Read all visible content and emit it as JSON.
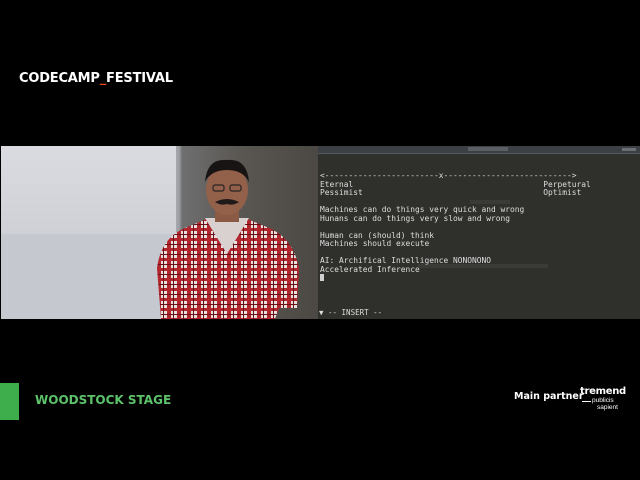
{
  "header": {
    "brand_main": "CODECAMP",
    "brand_accent": "_",
    "brand_tail": "FESTIVAL"
  },
  "colors": {
    "brand_accent": "#e84b1a",
    "stage_green": "#3dae4b",
    "terminal_bg": "#2f302c"
  },
  "terminal": {
    "lines": [
      "<------------------------x--------------------------->",
      "Eternal                                        Perpetural",
      "Pessimist                                      Optimist",
      "",
      "Machines can do things very quick and wrong",
      "Hunans can do things very slow and wrong",
      "",
      "Human can (should) think",
      "Machines should execute",
      "",
      "AI: Archifical Intelligence NONONONO",
      "Accelerated Inference"
    ],
    "mode": "-- INSERT --"
  },
  "footer": {
    "stage_name": "WOODSTOCK STAGE",
    "partner_label": "Main partner",
    "partner_logo_top": "tremend",
    "partner_logo_mid": "publicis",
    "partner_logo_bot": "sapient"
  }
}
